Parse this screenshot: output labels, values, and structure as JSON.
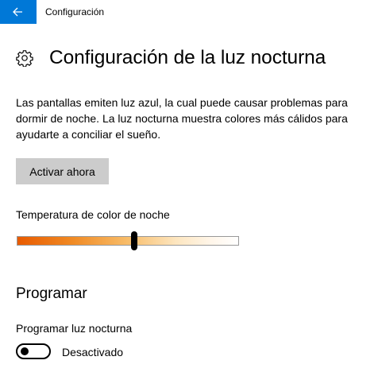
{
  "window": {
    "title": "Configuración",
    "accent_color": "#0078d7",
    "back_icon": "arrow-left-icon"
  },
  "header": {
    "icon": "gear-icon",
    "title": "Configuración de la luz nocturna"
  },
  "description": "Las pantallas emiten luz azul, la cual puede causar problemas para dormir de noche. La luz nocturna muestra colores más cálidos para ayudarte a conciliar el sueño.",
  "activate_button": {
    "label": "Activar ahora"
  },
  "color_temperature": {
    "label": "Temperatura de color de noche",
    "value_fraction": 0.53
  },
  "schedule": {
    "heading": "Programar",
    "toggle_label": "Programar luz nocturna",
    "toggle_state": "Desactivado",
    "toggle_on": false
  }
}
